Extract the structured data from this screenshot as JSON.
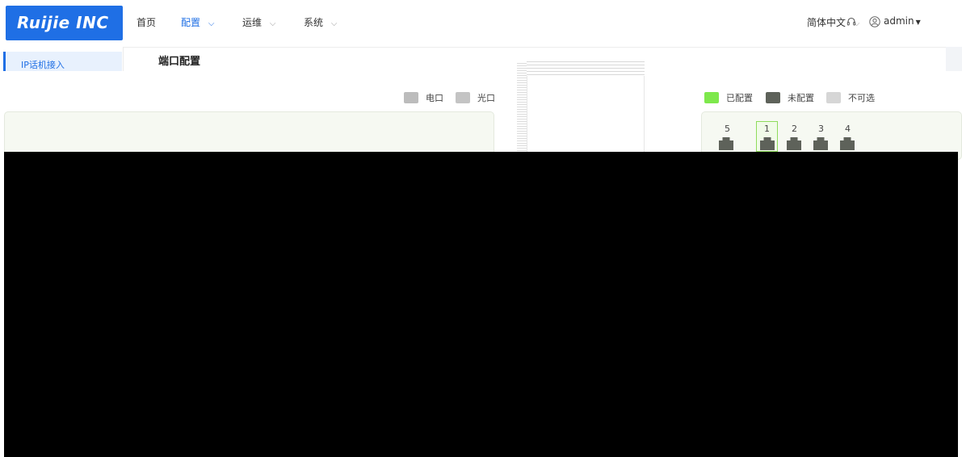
{
  "app": {
    "logo_text": "Ruijie INC"
  },
  "nav": {
    "items": [
      {
        "label": "首页",
        "has_dropdown": false,
        "active": false
      },
      {
        "label": "配置",
        "has_dropdown": true,
        "active": true
      },
      {
        "label": "运维",
        "has_dropdown": true,
        "active": false
      },
      {
        "label": "系统",
        "has_dropdown": true,
        "active": false
      }
    ],
    "chevron": "⌵"
  },
  "header_right": {
    "language": "简体中文",
    "user": "admin",
    "icons": [
      "headset-icon",
      "user-icon"
    ]
  },
  "sidebar": {
    "items": [
      {
        "label": "IP话机接入",
        "active": true
      }
    ]
  },
  "page": {
    "title": "端口配置"
  },
  "legend_left": [
    {
      "label": "电口",
      "color": "#bcbcbc"
    },
    {
      "label": "光口",
      "color": "#c4c4c4"
    }
  ],
  "legend_right": [
    {
      "label": "已配置",
      "color": "#7ee84c"
    },
    {
      "label": "未配置",
      "color": "#5e625a"
    },
    {
      "label": "不可选",
      "color": "#d6d6d6"
    }
  ],
  "ports": [
    {
      "label": "5"
    },
    {
      "label": "1",
      "selected": true
    },
    {
      "label": "2"
    },
    {
      "label": "3"
    },
    {
      "label": "4"
    }
  ],
  "colors": {
    "accent": "#1f6fe5",
    "configured": "#7ee84c",
    "unconfigured": "#5e625a",
    "unavailable": "#d6d6d6",
    "panel_bg": "#f6f9f2"
  }
}
